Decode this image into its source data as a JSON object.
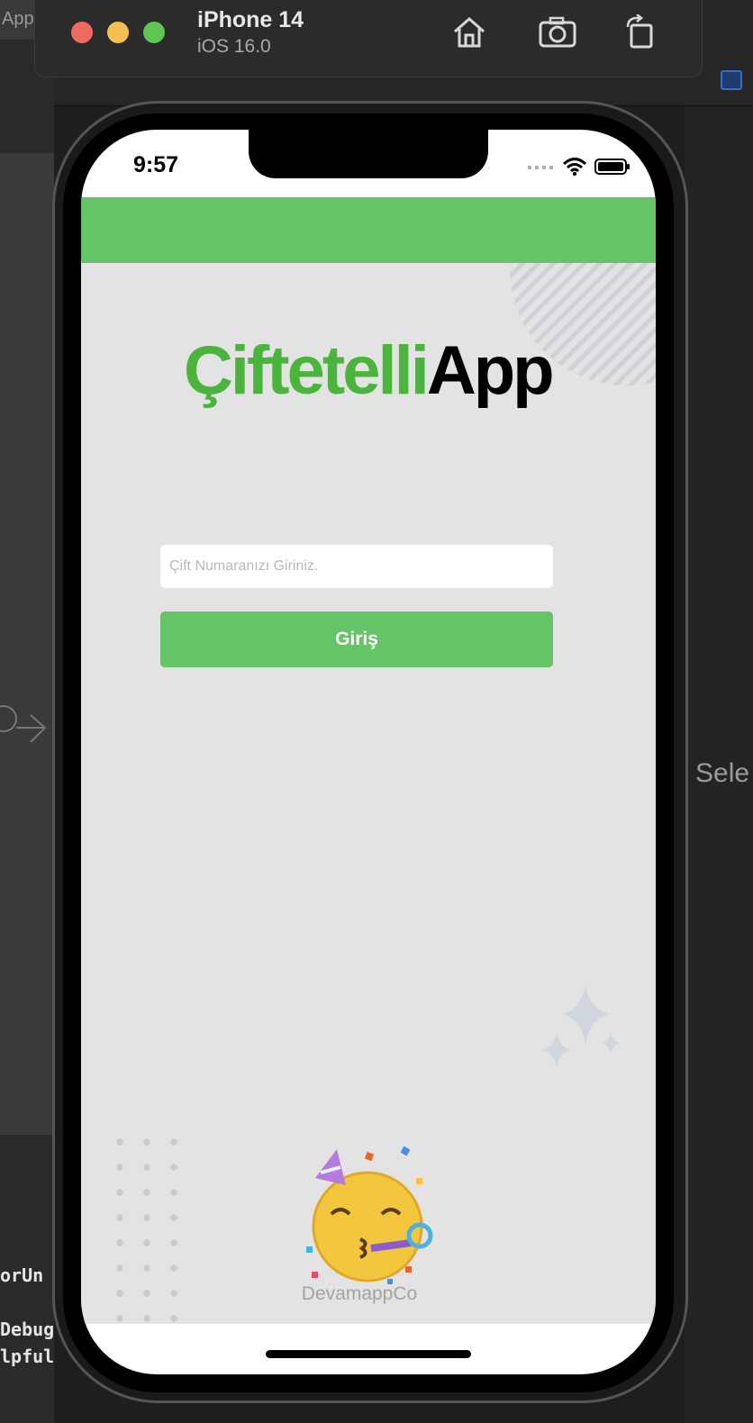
{
  "xcode_background": {
    "tab_label": "App",
    "right_panel_text": "Sele",
    "code_lines": [
      "orUn",
      "Debug",
      "lpful"
    ]
  },
  "simulator": {
    "device_name": "iPhone 14",
    "os_version": "iOS 16.0",
    "buttons": [
      "home-icon",
      "screenshot-icon",
      "rotate-icon"
    ]
  },
  "status_bar": {
    "time": "9:57",
    "icons": [
      "cellular-icon",
      "wifi-icon",
      "battery-icon"
    ]
  },
  "app": {
    "header_color": "#65c466",
    "logo": {
      "green_part": "Çiftetelli",
      "black_part": "App"
    },
    "input": {
      "placeholder": "Çift Numaranızı Giriniz.",
      "value": ""
    },
    "login_button_label": "Giriş",
    "footer_text": "DevamappCo",
    "colors": {
      "brand_green": "#65c466",
      "logo_green": "#4bb43c",
      "background": "#e3e3e3"
    }
  }
}
